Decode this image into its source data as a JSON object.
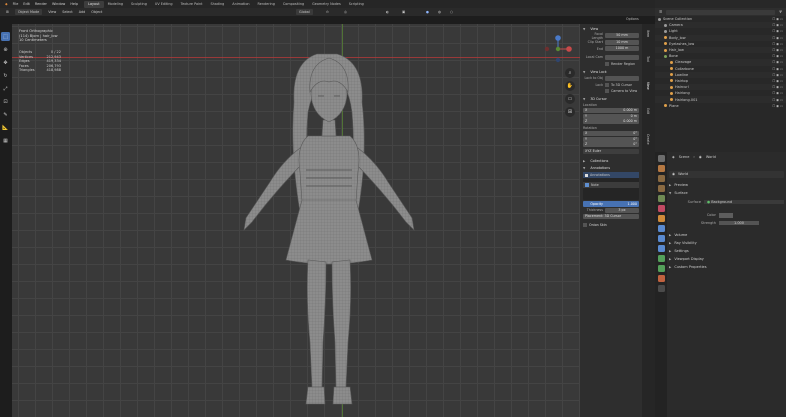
{
  "topbar": {
    "menus": [
      "File",
      "Edit",
      "Render",
      "Window",
      "Help"
    ],
    "workspaces": [
      "Layout",
      "Modeling",
      "Sculpting",
      "UV Editing",
      "Texture Paint",
      "Shading",
      "Animation",
      "Rendering",
      "Compositing",
      "Geometry Nodes",
      "Scripting"
    ],
    "active_workspace": "Layout",
    "scene_label": "Scene",
    "viewlayer_label": "ViewLayer"
  },
  "viewport_header": {
    "mode": "Object Mode",
    "menus": [
      "View",
      "Select",
      "Add",
      "Object"
    ],
    "transform": "Global",
    "options": "Options"
  },
  "overlay_info": {
    "view_name": "Front Orthographic",
    "object_line": "(114) Bjorn | hair_low",
    "units": "10 Centimeters"
  },
  "stats": [
    {
      "label": "Objects",
      "value": "0 / 22"
    },
    {
      "label": "Vertices",
      "value": "212,943"
    },
    {
      "label": "Edges",
      "value": "419,334"
    },
    {
      "label": "Faces",
      "value": "206,793"
    },
    {
      "label": "Triangles",
      "value": "418,988"
    }
  ],
  "npanel": {
    "view_section": "View",
    "focal_label": "Focal Length",
    "focal_value": "50 mm",
    "clip_start_label": "Clip Start",
    "clip_start_value": "10 mm",
    "clip_end_label": "End",
    "clip_end_value": "1000 m",
    "local_camera_label": "Local Cam",
    "render_region": "Render Region",
    "view_lock": "View Lock",
    "lock_object_label": "Lock to Obj",
    "lock_label": "Lock",
    "lock_3d_cursor": "To 3D Cursor",
    "camera_to_view": "Camera to View",
    "cursor_section": "3D Cursor",
    "location_label": "Location",
    "location": [
      {
        "axis": "X",
        "value": "0.000 m"
      },
      {
        "axis": "Y",
        "value": "0 m"
      },
      {
        "axis": "Z",
        "value": "0.000 m"
      }
    ],
    "rotation_label": "Rotation",
    "rotation": [
      {
        "axis": "X",
        "value": "0°"
      },
      {
        "axis": "Y",
        "value": "0°"
      },
      {
        "axis": "Z",
        "value": "0°"
      }
    ],
    "rotation_mode": "XYZ Euler",
    "collections_section": "Collections",
    "annotations_section": "Annotations",
    "annotation_layer": "Annotations",
    "note_label": "Note",
    "opacity_label": "Opacity",
    "opacity_value": "1.000",
    "thickness_label": "Thickness",
    "thickness_value": "3 px",
    "placement": "Placement: 3D Cursor",
    "onion_skin": "Onion Skin"
  },
  "ntabs": [
    "Item",
    "Tool",
    "View",
    "Edit",
    "Create"
  ],
  "outliner": {
    "title": "Scene Collection",
    "rows": [
      {
        "name": "Scene Collection",
        "color": "#9a9a9a",
        "indent": 0
      },
      {
        "name": "Camera",
        "color": "#9a9a9a",
        "indent": 1
      },
      {
        "name": "Light",
        "color": "#9a9a9a",
        "indent": 1
      },
      {
        "name": "Body_low",
        "color": "#e0a04a",
        "indent": 1
      },
      {
        "name": "Eyelashes_low",
        "color": "#e0a04a",
        "indent": 1
      },
      {
        "name": "Hair_low",
        "color": "#e0a04a",
        "indent": 1
      },
      {
        "name": "Bone",
        "color": "#7aa05a",
        "indent": 1
      },
      {
        "name": "Cleavage",
        "color": "#e0a04a",
        "indent": 2
      },
      {
        "name": "Collarbone",
        "color": "#e0a04a",
        "indent": 2
      },
      {
        "name": "Lowline",
        "color": "#e0a04a",
        "indent": 2
      },
      {
        "name": "Hairtop",
        "color": "#e0a04a",
        "indent": 2
      },
      {
        "name": "Haircurl",
        "color": "#e0a04a",
        "indent": 2
      },
      {
        "name": "Hairlong",
        "color": "#e0a04a",
        "indent": 2
      },
      {
        "name": "Hairlong.001",
        "color": "#e0a04a",
        "indent": 2
      },
      {
        "name": "Plane",
        "color": "#e0a04a",
        "indent": 1
      }
    ]
  },
  "properties": {
    "breadcrumb_scene": "Scene",
    "breadcrumb_world": "World",
    "world_name": "World",
    "preview": "Preview",
    "surface": "Surface",
    "surface_label": "Surface",
    "surface_value": "Background",
    "color_label": "Color",
    "strength_label": "Strength",
    "strength_value": "1.000",
    "volume": "Volume",
    "ray_visibility": "Ray Visibility",
    "settings": "Settings",
    "viewport_display": "Viewport Display",
    "custom_properties": "Custom Properties"
  },
  "colors": {
    "accent": "#4772b3",
    "x_axis": "#b13a3a",
    "y_axis": "#5a8a33",
    "grid": "#393939"
  }
}
